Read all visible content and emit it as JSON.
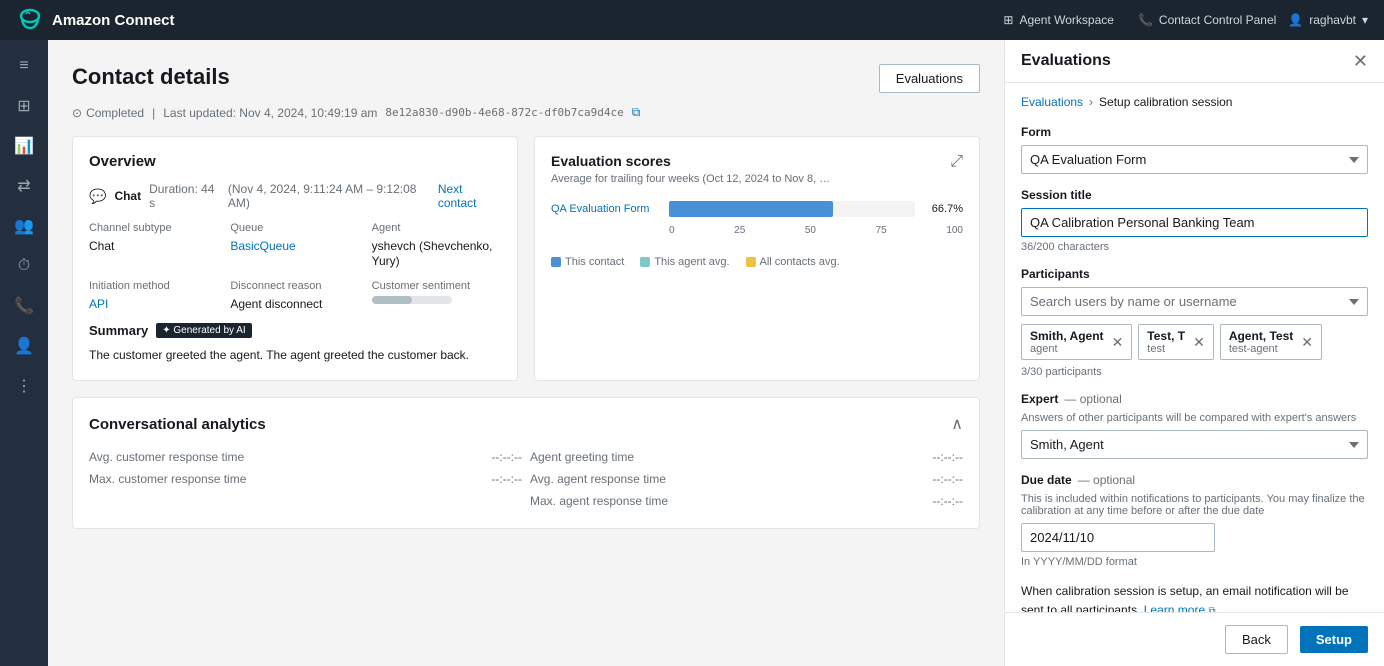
{
  "topnav": {
    "brand": "Amazon Connect",
    "links": [
      {
        "id": "agent-workspace",
        "label": "Agent Workspace",
        "icon": "grid-icon"
      },
      {
        "id": "contact-control-panel",
        "label": "Contact Control Panel",
        "icon": "phone-icon"
      }
    ],
    "user": "raghavbt"
  },
  "sidebar": {
    "items": [
      {
        "id": "menu",
        "icon": "≡"
      },
      {
        "id": "dashboard",
        "icon": "⊞"
      },
      {
        "id": "charts",
        "icon": "📊"
      },
      {
        "id": "flows",
        "icon": "⇄"
      },
      {
        "id": "users",
        "icon": "👥"
      },
      {
        "id": "clock",
        "icon": "⏱"
      },
      {
        "id": "phone",
        "icon": "📞"
      },
      {
        "id": "person",
        "icon": "👤"
      },
      {
        "id": "more",
        "icon": "⋮"
      }
    ]
  },
  "contact_details": {
    "title": "Contact details",
    "evaluations_button": "Evaluations",
    "status": "Completed",
    "last_updated": "Last updated: Nov 4, 2024, 10:49:19 am",
    "contact_id": "8e12a830-d90b-4e68-872c-df0b7ca9d4ce",
    "overview": {
      "title": "Overview",
      "chat_label": "Chat",
      "duration": "Duration: 44 s",
      "time_range": "(Nov 4, 2024, 9:11:24 AM – 9:12:08 AM)",
      "next_contact": "Next contact",
      "fields": [
        {
          "label": "Channel subtype",
          "value": "Chat",
          "type": "text"
        },
        {
          "label": "Queue",
          "value": "BasicQueue",
          "type": "link"
        },
        {
          "label": "Agent",
          "value": "yshevch (Shevchenko, Yury)",
          "type": "text"
        },
        {
          "label": "Initiation method",
          "value": "API",
          "type": "link"
        },
        {
          "label": "Disconnect reason",
          "value": "Agent disconnect",
          "type": "text"
        },
        {
          "label": "Customer sentiment",
          "value": "",
          "type": "sentiment"
        }
      ],
      "summary_label": "Summary",
      "ai_badge": "✦ Generated by AI",
      "summary_text": "The customer greeted the agent. The agent greeted the customer back."
    },
    "eval_scores": {
      "title": "Evaluation scores",
      "subtitle": "Average for trailing four weeks (Oct 12, 2024 to Nov 8, …",
      "rows": [
        {
          "name": "QA Evaluation Form",
          "pct": 66.7,
          "label": "66.7%"
        }
      ],
      "axis": [
        "0",
        "25",
        "50",
        "75",
        "100"
      ],
      "legend": [
        {
          "label": "This contact",
          "color": "#4a90d9"
        },
        {
          "label": "This agent avg.",
          "color": "#7ec8c8"
        },
        {
          "label": "All contacts avg.",
          "color": "#f0c040"
        }
      ]
    },
    "analytics": {
      "title": "Conversational analytics",
      "rows_left": [
        {
          "label": "Avg. customer response time",
          "value": "--:--:--"
        },
        {
          "label": "Max. customer response time",
          "value": "--:--:--"
        }
      ],
      "rows_right": [
        {
          "label": "Agent greeting time",
          "value": "--:--:--"
        },
        {
          "label": "Avg. agent response time",
          "value": "--:--:--"
        },
        {
          "label": "Max. agent response time",
          "value": "--:--:--"
        }
      ]
    }
  },
  "right_panel": {
    "title": "Evaluations",
    "breadcrumb": {
      "parent": "Evaluations",
      "current": "Setup calibration session"
    },
    "form": {
      "label": "Form",
      "selected": "QA Evaluation Form",
      "options": [
        "QA Evaluation Form"
      ]
    },
    "session_title": {
      "label": "Session title",
      "value": "QA Calibration Personal Banking Team",
      "char_count": "36/200 characters"
    },
    "participants": {
      "label": "Participants",
      "search_placeholder": "Search users by name or username",
      "tags": [
        {
          "name": "Smith, Agent",
          "role": "agent"
        },
        {
          "name": "Test, T",
          "role": "test"
        },
        {
          "name": "Agent, Test",
          "role": "test-agent"
        }
      ],
      "count": "3/30 participants"
    },
    "expert": {
      "label": "Expert",
      "optional": "— optional",
      "sublabel": "Answers of other participants will be compared with expert's answers",
      "selected": "Smith, Agent",
      "options": [
        "Smith, Agent"
      ]
    },
    "due_date": {
      "label": "Due date",
      "optional": "— optional",
      "description": "This is included within notifications to participants. You may finalize the calibration at any time before or after the due date",
      "value": "2024/11/10",
      "format_hint": "In YYYY/MM/DD format"
    },
    "notification": {
      "text": "When calibration session is setup, an email notification will be sent to all participants.",
      "learn_more": "Learn more"
    },
    "footer": {
      "back_label": "Back",
      "setup_label": "Setup"
    }
  }
}
